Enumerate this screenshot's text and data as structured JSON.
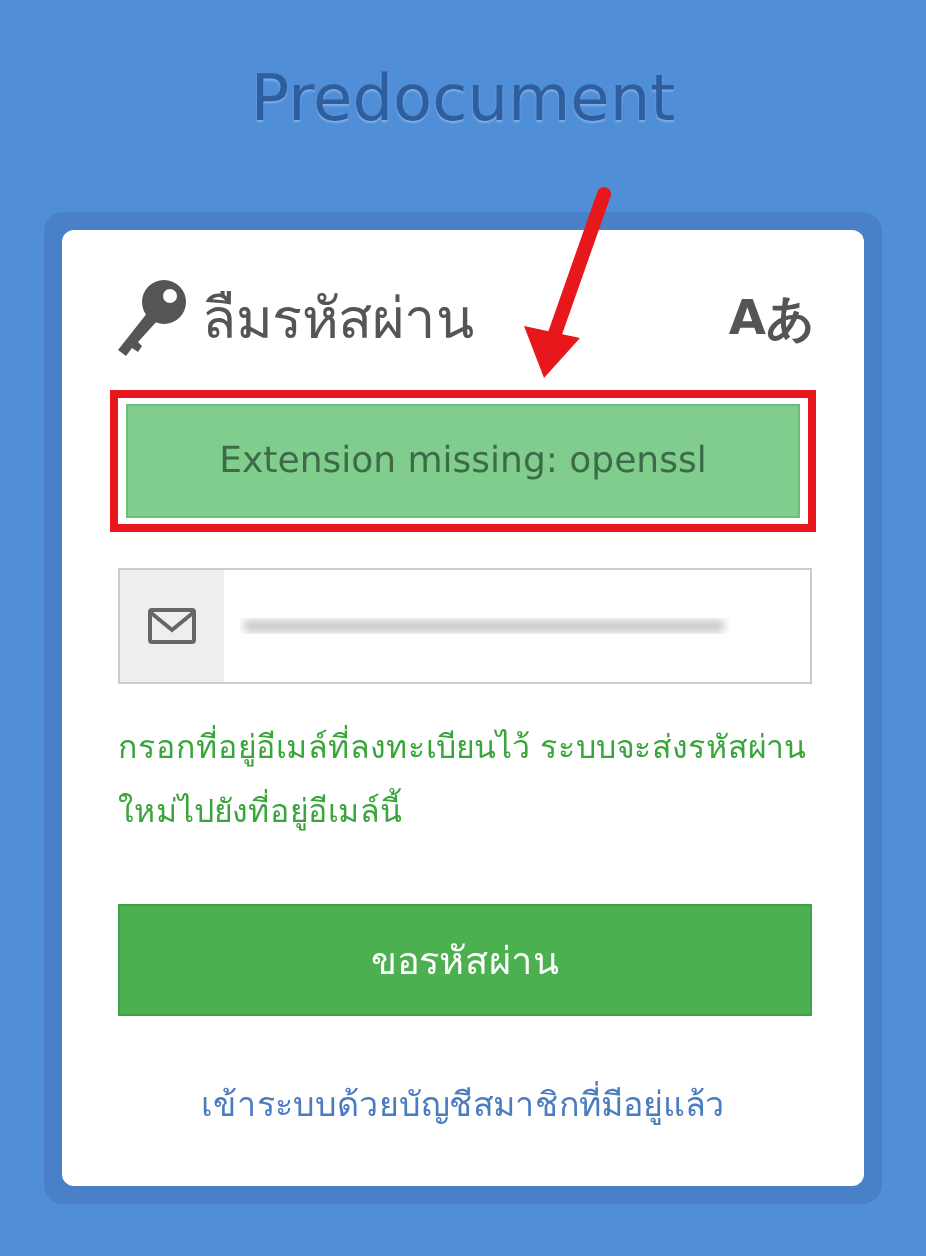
{
  "brand": "Predocument",
  "card": {
    "title": "ลืมรหัสผ่าน",
    "language_button": "Aあ",
    "alert": {
      "kind": "success",
      "text": "Extension missing: openssl",
      "highlighted": true
    },
    "email_field": {
      "redacted": true
    },
    "help_text": "กรอกที่อยู่อีเมล์ที่ลงทะเบียนไว้ ระบบจะส่งรหัสผ่านใหม่ไปยังที่อยู่อีเมล์นี้",
    "submit_button": "ขอรหัสผ่าน",
    "login_link": "เข้าระบบด้วยบัญชีสมาชิกที่มีอยู่แล้ว"
  }
}
